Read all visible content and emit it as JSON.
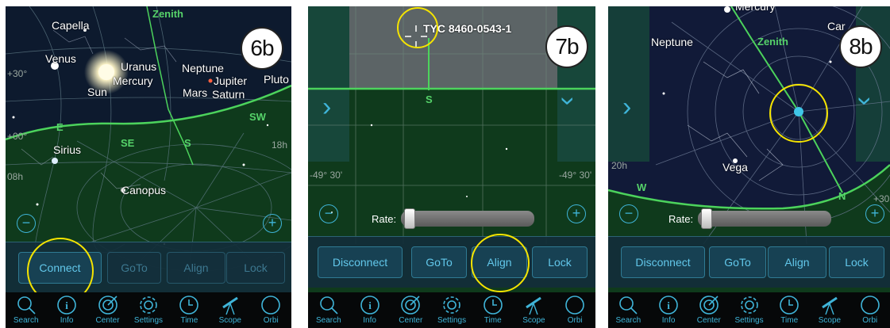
{
  "panels": [
    {
      "badge": "6b",
      "labels": {
        "capella": "Capella",
        "zenith": "Zenith",
        "venus": "Venus",
        "uranus": "Uranus",
        "mercury": "Mercury",
        "neptune": "Neptune",
        "jupiter": "Jupiter",
        "pluto": "Pluto",
        "sun": "Sun",
        "mars": "Mars",
        "saturn": "Saturn",
        "e": "E",
        "se": "SE",
        "s": "S",
        "sw": "SW",
        "sirius": "Sirius",
        "canopus": "Canopus",
        "c30": "+30°",
        "c00": "+00°",
        "c08h": "08h",
        "c18h": "18h"
      },
      "buttons": {
        "connect": "Connect",
        "goto": "GoTo",
        "align": "Align",
        "lock": "Lock"
      }
    },
    {
      "badge": "7b",
      "labels": {
        "target": "TYC 8460-0543-1",
        "s": "S",
        "dec_left": "-49° 30'",
        "dec_right": "-49° 30'"
      },
      "rate_label": "Rate:",
      "rate_value": 0.02,
      "buttons": {
        "disconnect": "Disconnect",
        "goto": "GoTo",
        "align": "Align",
        "lock": "Lock"
      }
    },
    {
      "badge": "8b",
      "labels": {
        "mercury": "Mercury",
        "car": "Car",
        "neptune": "Neptune",
        "zenith": "Zenith",
        "vega": "Vega",
        "w": "W",
        "n": "N",
        "c20h": "20h",
        "c30": "+30°"
      },
      "rate_label": "Rate:",
      "rate_value": 0.02,
      "buttons": {
        "disconnect": "Disconnect",
        "goto": "GoTo",
        "align": "Align",
        "lock": "Lock"
      }
    }
  ],
  "tabs": {
    "search": "Search",
    "info": "Info",
    "center": "Center",
    "settings": "Settings",
    "time": "Time",
    "scope": "Scope",
    "orbit": "Orbi"
  },
  "colors": {
    "accent": "#3fb4d8",
    "ground": "#0f3a1c",
    "horizon": "#4cd35c",
    "highlight": "#f5e400"
  }
}
